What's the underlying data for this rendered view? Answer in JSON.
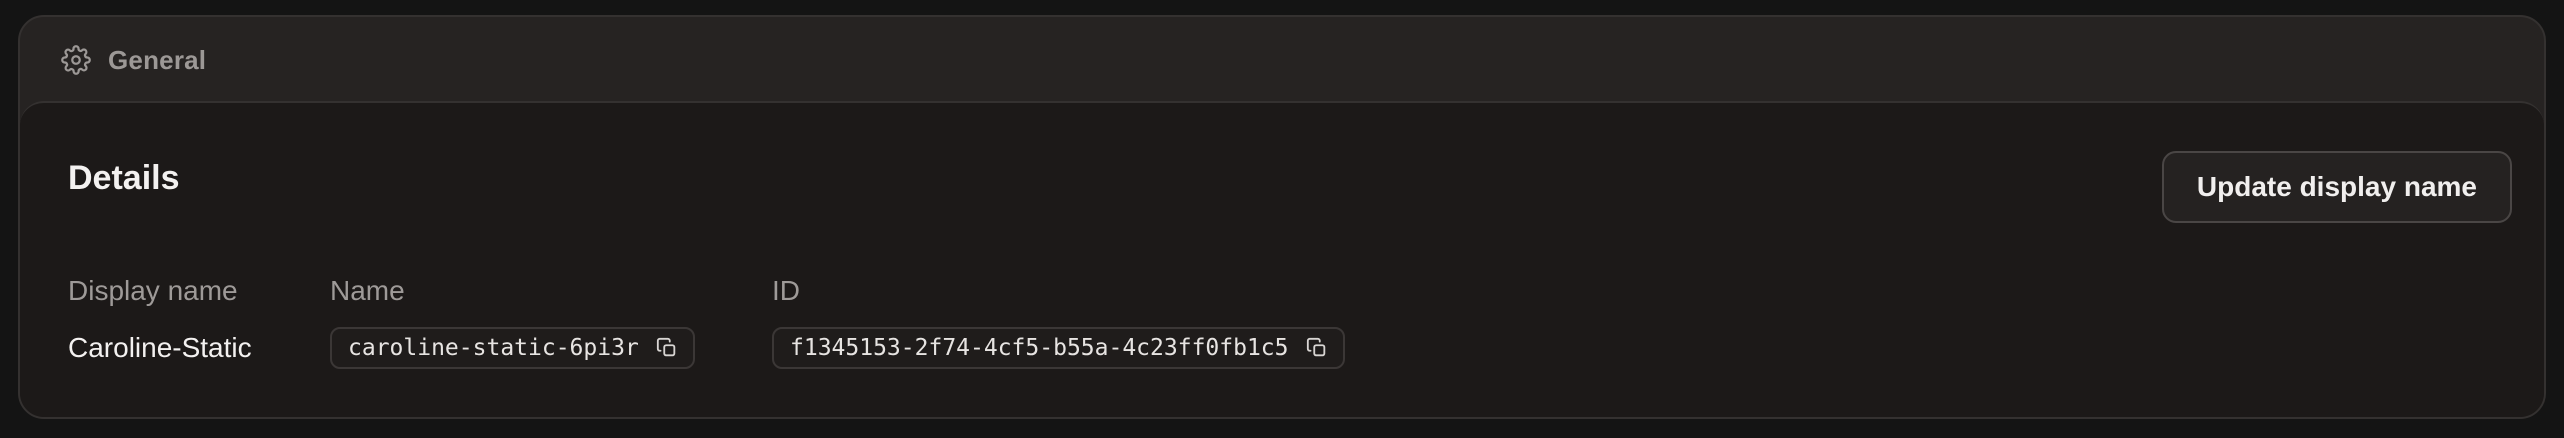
{
  "header": {
    "title": "General",
    "icon": "gear-icon"
  },
  "details": {
    "title": "Details",
    "update_button_label": "Update display name",
    "fields": {
      "display_name": {
        "label": "Display name",
        "value": "Caroline-Static"
      },
      "name": {
        "label": "Name",
        "value": "caroline-static-6pi3r",
        "icon": "copy-icon"
      },
      "id": {
        "label": "ID",
        "value": "f1345153-2f74-4cf5-b55a-4c23ff0fb1c5",
        "icon": "copy-icon"
      }
    }
  },
  "colors": {
    "page_background": "#141414",
    "header_background": "#262322",
    "body_background": "#1c1918",
    "border": "#343130",
    "muted_text": "#9e9a98",
    "primary_text": "#f3f1f0"
  }
}
